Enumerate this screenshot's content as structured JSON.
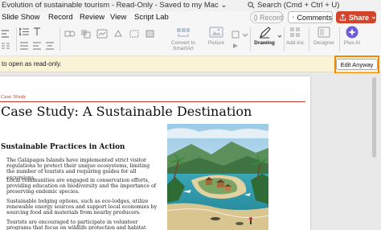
{
  "titlebar": {
    "title": "Evolution of sustainable tourism  -  Read-Only  -  Saved to my Mac ⌄",
    "search_placeholder": "Search (Cmd + Ctrl + U)"
  },
  "tabs": [
    "Slide Show",
    "Record",
    "Review",
    "View",
    "Script Lab"
  ],
  "actions": {
    "record": "Record",
    "comments": "Comments",
    "share": "Share"
  },
  "ribbon": {
    "convert_to_smartart": "Convert to SmartArt",
    "picture": "Picture",
    "drawing": "Drawing",
    "addins": "Add-ins",
    "designer": "Designer",
    "plus_ai": "Plus AI"
  },
  "notice": {
    "message": "to open as read-only.",
    "button": "Edit Anyway"
  },
  "document": {
    "kicker": "Case Study",
    "title": "Case Study: A Sustainable Destination",
    "section_title": "Sustainable Practices in Action",
    "paragraphs": [
      "The Galápagos Islands have implemented strict visitor regulations to protect their unique ecosystems, limiting the number of tourists and requiring guides for all excursions.",
      "Local communities are engaged in conservation efforts, providing education on biodiversity and the importance of preserving endemic species.",
      "Sustainable lodging options, such as eco-lodges, utilize renewable energy sources and support local economies by sourcing food and materials from nearby producers.",
      "Tourists are encouraged to participate in volunteer programs that focus on wildlife protection and habitat"
    ]
  },
  "colors": {
    "accent_orange": "#f08a00",
    "share_red": "#d2442c",
    "kicker_red": "#c0392b",
    "notice_bg": "#fbf3d7"
  }
}
